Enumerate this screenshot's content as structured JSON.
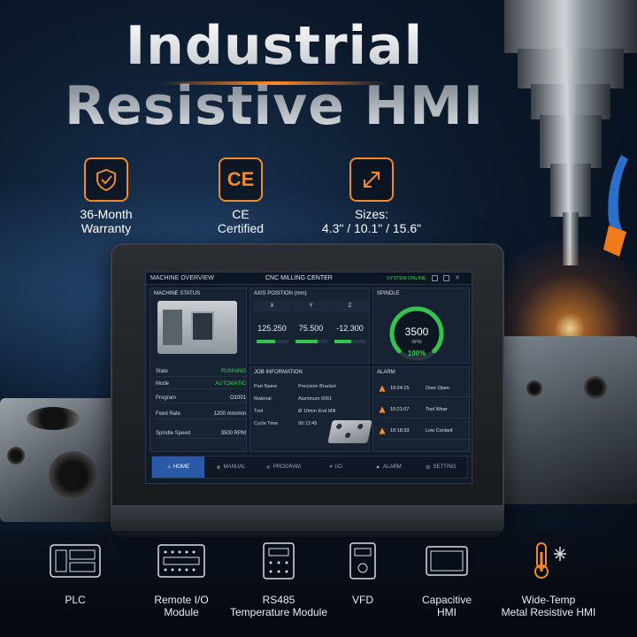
{
  "title": {
    "line1": "Industrial",
    "line2": "Resistive HMI"
  },
  "features": [
    {
      "icon": "shield-check-icon",
      "line1": "36-Month",
      "line2": "Warranty"
    },
    {
      "icon": "ce-mark-icon",
      "symbol": "CE",
      "line1": "CE",
      "line2": "Certified"
    },
    {
      "icon": "expand-arrows-icon",
      "line1": "Sizes:",
      "line2": "4.3\" / 10.1\" / 15.6\""
    }
  ],
  "hmi": {
    "header": {
      "left": "MACHINE OVERVIEW",
      "center": "CNC MILLING CENTER",
      "status": "SYSTEM ONLINE"
    },
    "machine_status": {
      "title": "MACHINE STATUS",
      "rows": [
        {
          "label": "State",
          "value": "RUNNING"
        },
        {
          "label": "Mode",
          "value": "AUTOMATIC"
        },
        {
          "label": "Program",
          "value": "O1001"
        },
        {
          "label": "Feed Rate",
          "value": "1200 mm/min"
        },
        {
          "label": "Spindle Speed",
          "value": "3500 RPM"
        }
      ]
    },
    "axis_position": {
      "title": "AXIS POSITION (mm)",
      "axes": [
        {
          "name": "X",
          "value": "125.250",
          "level": 0.6
        },
        {
          "name": "Y",
          "value": "75.500",
          "level": 0.7
        },
        {
          "name": "Z",
          "value": "-12.300",
          "level": 0.55
        }
      ]
    },
    "spindle": {
      "title": "SPINDLE",
      "value": "3500",
      "unit": "RPM",
      "percent": "100%",
      "level": 1.0
    },
    "job": {
      "title": "JOB INFORMATION",
      "rows": [
        {
          "label": "Part Name",
          "value": "Precision Bracket"
        },
        {
          "label": "Material",
          "value": "Aluminum 6061"
        },
        {
          "label": "Tool",
          "value": "Ø 10mm End Mill"
        },
        {
          "label": "Cycle Time",
          "value": "00:12:45"
        }
      ]
    },
    "alarm": {
      "title": "ALARM",
      "rows": [
        {
          "time": "10:24:15",
          "message": "Door Open"
        },
        {
          "time": "10:21:07",
          "message": "Tool Wear"
        },
        {
          "time": "10:18:33",
          "message": "Low Coolant"
        }
      ]
    },
    "nav": [
      {
        "label": "HOME",
        "icon": "home-icon",
        "active": true
      },
      {
        "label": "MANUAL",
        "icon": "manual-icon",
        "active": false
      },
      {
        "label": "PROGRAM",
        "icon": "program-icon",
        "active": false
      },
      {
        "label": "I/O",
        "icon": "io-icon",
        "active": false
      },
      {
        "label": "ALARM",
        "icon": "alarm-icon",
        "active": false
      },
      {
        "label": "SETTING",
        "icon": "gear-icon",
        "active": false
      }
    ]
  },
  "products": [
    {
      "icon": "plc-icon",
      "line1": "PLC",
      "line2": ""
    },
    {
      "icon": "remote-io-icon",
      "line1": "Remote I/O",
      "line2": "Module"
    },
    {
      "icon": "rs485-module-icon",
      "line1": "RS485",
      "line2": "Temperature Module"
    },
    {
      "icon": "vfd-icon",
      "line1": "VFD",
      "line2": ""
    },
    {
      "icon": "capacitive-hmi-icon",
      "line1": "Capacitive",
      "line2": "HMI"
    },
    {
      "icon": "thermometer-snowflake-icon",
      "line1": "Wide-Temp",
      "line2": "Metal Resistive HMI"
    }
  ],
  "colors": {
    "accent": "#f08a2a",
    "ok": "#3ccf5a",
    "nav_active": "#2a5aa5",
    "warning": "#f08a2a"
  }
}
